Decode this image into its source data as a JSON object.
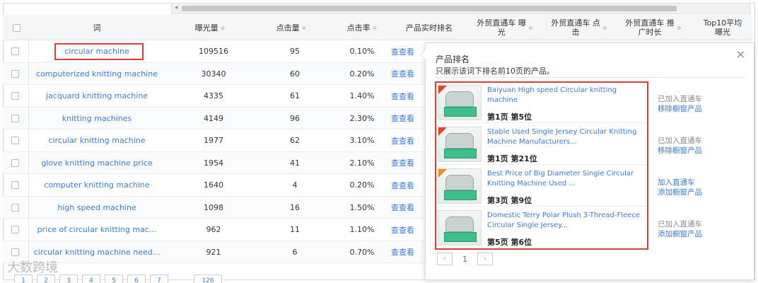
{
  "header": {
    "col_word": "词",
    "col_impressions": "曝光量",
    "col_clicks": "点击量",
    "col_ctr": "点击率",
    "col_rank": "产品实时排名",
    "col_p4p_imp": "外贸直通车 曝光",
    "col_p4p_clk": "外贸直通车 点击",
    "col_p4p_time": "外贸直通车 推广时长",
    "col_top10": "Top10平均 曝光",
    "sort_glyph": "≑"
  },
  "rows": [
    {
      "kw": "circular machine",
      "imp": "109516",
      "clk": "95",
      "ctr": "0.10%",
      "link": "查查看"
    },
    {
      "kw": "computerized knitting machine",
      "imp": "30340",
      "clk": "60",
      "ctr": "0.20%",
      "link": "查查看"
    },
    {
      "kw": "jacquard knitting machine",
      "imp": "4335",
      "clk": "61",
      "ctr": "1.40%",
      "link": "查查看"
    },
    {
      "kw": "knitting machines",
      "imp": "4149",
      "clk": "96",
      "ctr": "2.30%",
      "link": "查查看"
    },
    {
      "kw": "circular knitting machine",
      "imp": "1977",
      "clk": "62",
      "ctr": "3.10%",
      "link": "查查看"
    },
    {
      "kw": "glove knitting machine price",
      "imp": "1954",
      "clk": "41",
      "ctr": "2.10%",
      "link": "查查看"
    },
    {
      "kw": "computer knitting machine",
      "imp": "1640",
      "clk": "4",
      "ctr": "0.20%",
      "link": "查查看"
    },
    {
      "kw": "high speed machine",
      "imp": "1098",
      "clk": "16",
      "ctr": "1.50%",
      "link": "查查看"
    },
    {
      "kw": "price of circular knitting mac...",
      "imp": "962",
      "clk": "11",
      "ctr": "1.10%",
      "link": "查查看"
    },
    {
      "kw": "circular knitting machine need...",
      "imp": "921",
      "clk": "6",
      "ctr": "0.70%",
      "link": "查查看"
    }
  ],
  "pager": {
    "pages": [
      "1",
      "2",
      "3",
      "4",
      "5",
      "6",
      "7"
    ],
    "last": "126"
  },
  "watermark": "大数跨境",
  "popup": {
    "title": "产品排名",
    "subtitle": "只展示该词下排名前10页的产品。",
    "close": "×",
    "items": [
      {
        "name": "Baiyuan High speed Circular knitting machine",
        "rank": "第1页 第5位",
        "status": "已加入直通车",
        "action": "移除橱窗产品"
      },
      {
        "name": "Stable Used Single Jersey Circular Knitting Machine Manufacturers...",
        "rank": "第1页 第21位",
        "status": "已加入直通车",
        "action": "移除橱窗产品"
      },
      {
        "name": "Best Price of Big Diameter Single Circular Knitting Machine Used ...",
        "rank": "第3页 第9位",
        "status": "加入直通车",
        "action": "添加橱窗产品"
      },
      {
        "name": "Domestic Terry Polar Plush 3-Thread-Fleece Circular Single Jersey...",
        "rank": "第5页 第6位",
        "status": "已加入直通车",
        "action": "添加橱窗产品"
      }
    ],
    "nav": {
      "prev": "‹",
      "page": "1",
      "next": "›"
    }
  },
  "colors": {
    "link": "#3a7bd5",
    "highlight": "#e03c3c"
  }
}
